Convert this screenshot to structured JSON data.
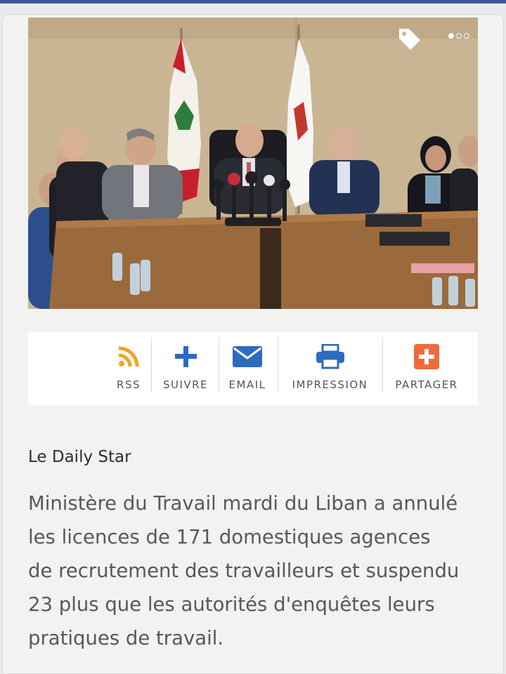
{
  "share_bar": {
    "items": [
      {
        "label": "RSS",
        "icon": "rss-icon",
        "color": "#f4a125"
      },
      {
        "label": "SUIVRE",
        "icon": "plus-icon",
        "color": "#2d6bbf"
      },
      {
        "label": "EMAIL",
        "icon": "envelope-icon",
        "color": "#2d6bbf"
      },
      {
        "label": "IMPRESSION",
        "icon": "printer-icon",
        "color": "#2d6bbf"
      },
      {
        "label": "PARTAGER",
        "icon": "plus-square-icon",
        "color": "#ef6a3b"
      }
    ]
  },
  "article": {
    "source": "Le Daily Star",
    "lines": [
      "Ministère du Travail mardi du Liban a annulé",
      "les licences de 171 domestiques agences",
      "de recrutement des travailleurs et suspendu",
      "23 plus que les autorités d'enquêtes leurs",
      "pratiques de travail."
    ]
  },
  "colors": {
    "accent": "#3b5998",
    "card_bg": "#f2f2f0",
    "text": "#585858"
  }
}
